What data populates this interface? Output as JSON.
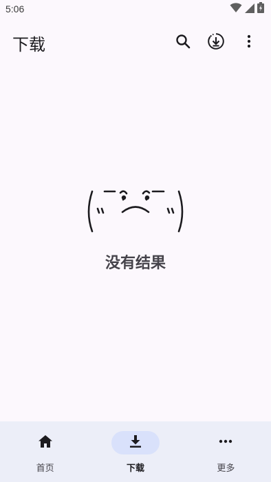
{
  "status_bar": {
    "time": "5:06",
    "icons": [
      "wifi-icon",
      "signal-icon",
      "battery-charging-icon"
    ]
  },
  "app_bar": {
    "title": "下载",
    "actions": [
      "search-icon",
      "download-manager-icon",
      "more-vert-icon"
    ]
  },
  "empty_state": {
    "kaomoji_icon": "frowning-kaomoji",
    "message": "没有结果"
  },
  "bottom_nav": {
    "items": [
      {
        "label": "首页",
        "icon": "home-icon",
        "active": false
      },
      {
        "label": "下载",
        "icon": "download-icon",
        "active": true
      },
      {
        "label": "更多",
        "icon": "more-horiz-icon",
        "active": false
      }
    ]
  },
  "colors": {
    "background": "#fcf8fd",
    "nav_background": "#eceef8",
    "active_pill": "#d9e1fb",
    "text": "#1c1b1f"
  }
}
